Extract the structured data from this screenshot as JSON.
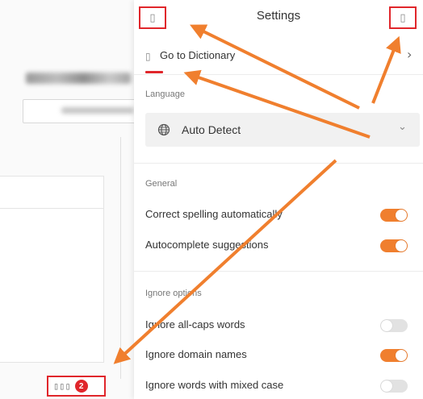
{
  "header": {
    "title": "Settings",
    "left_icon_glyph": "▯",
    "right_icon_glyph": "▯"
  },
  "dictionary_link": {
    "icon_glyph": "▯",
    "label": "Go to Dictionary",
    "chevron": "›"
  },
  "language": {
    "section_label": "Language",
    "selected": "Auto Detect",
    "icon": "globe-icon",
    "chevron": "⌄"
  },
  "general": {
    "section_label": "General",
    "options": [
      {
        "label": "Correct spelling automatically",
        "enabled": true
      },
      {
        "label": "Autocomplete suggestions",
        "enabled": true
      }
    ]
  },
  "ignore": {
    "section_label": "Ignore options",
    "options": [
      {
        "label": "Ignore all-caps words",
        "enabled": false
      },
      {
        "label": "Ignore domain names",
        "enabled": true
      },
      {
        "label": "Ignore words with mixed case",
        "enabled": false
      }
    ]
  },
  "extension_badge": {
    "glyphs": "▯▯▯",
    "count": "2"
  },
  "colors": {
    "accent": "#f07f2e",
    "highlight_red": "#e0262b",
    "arrow": "#f07f2e"
  }
}
